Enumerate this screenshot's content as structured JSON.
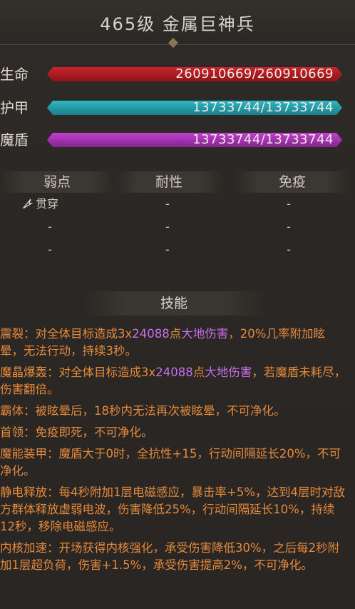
{
  "title": "465级 金属巨神兵",
  "stats": [
    {
      "label": "生命",
      "value": "260910669/260910669",
      "fill": 1.0,
      "color": "#c9232b",
      "color_dark": "#8e1418"
    },
    {
      "label": "护甲",
      "value": "13733744/13733744",
      "fill": 1.0,
      "color": "#2fb7c4",
      "color_dark": "#1b7f8a"
    },
    {
      "label": "魔盾",
      "value": "13733744/13733744",
      "fill": 1.0,
      "color": "#c33fd0",
      "color_dark": "#84248f"
    }
  ],
  "resistances": {
    "headers": [
      "弱点",
      "耐性",
      "免疫"
    ],
    "rows": [
      [
        "贯穿",
        "-",
        "-"
      ],
      [
        "-",
        "-",
        "-"
      ],
      [
        "-",
        "-",
        "-"
      ]
    ],
    "weakness_icon": "pierce-icon"
  },
  "skills_title": "技能",
  "skills": [
    {
      "parts": [
        "震裂：对全体目标造成3x",
        "24088",
        "点",
        "大地伤害",
        "，20%几率附加眩晕，无法行动，持续3秒。"
      ]
    },
    {
      "parts": [
        "魔晶爆轰：对全体目标造成3x",
        "24088",
        "点",
        "大地伤害",
        "，若魔盾未耗尽，伤害翻倍。"
      ]
    },
    {
      "parts": [
        "霸体：被眩晕后，18秒内无法再次被眩晕，不可净化。"
      ]
    },
    {
      "parts": [
        "首领：免疫即死，不可净化。"
      ]
    },
    {
      "parts": [
        "魔能装甲：魔盾大于0时，全抗性+15，行动间隔延长20%，不可净化。"
      ]
    },
    {
      "parts": [
        "静电释放：每4秒附加1层电磁感应，暴击率+5%，达到4层时对敌方群体释放虚弱电波，伤害降低25%，行动间隔延长10%，持续12秒，移除电磁感应。"
      ]
    },
    {
      "parts": [
        "内核加速：开场获得内核强化，承受伤害降低30%，之后每2秒附加1层超负荷，伤害+1.5%，承受伤害提高2%，不可净化。"
      ]
    }
  ],
  "colors": {
    "skill_text": "#e58a3c",
    "keyword": "#c76fe8"
  }
}
